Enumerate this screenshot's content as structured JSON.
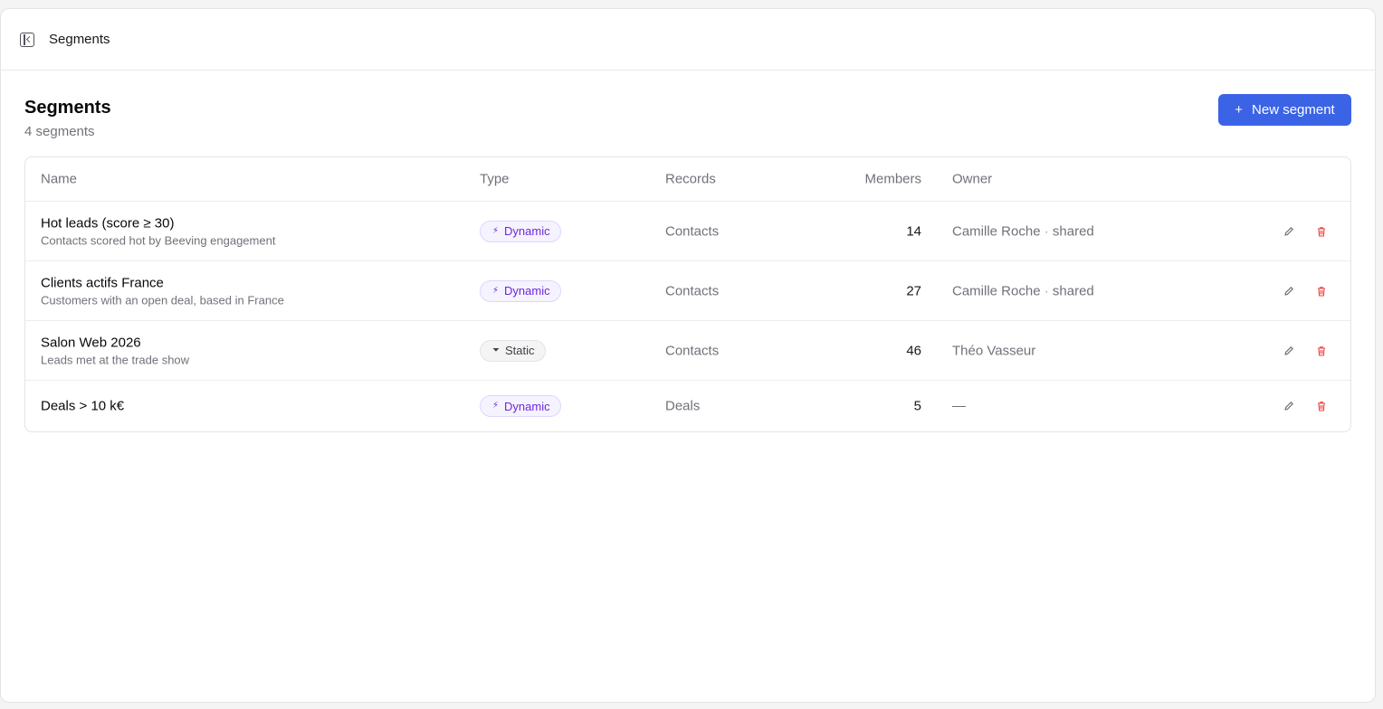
{
  "topbar": {
    "title": "Segments",
    "toggle_icon": "sidebar-toggle-icon"
  },
  "header": {
    "title": "Segments",
    "subtitle": "4 segments",
    "new_button_label": "New segment"
  },
  "table": {
    "columns": {
      "name": "Name",
      "type": "Type",
      "records": "Records",
      "members": "Members",
      "owner": "Owner"
    },
    "rows": [
      {
        "name": "Hot leads (score ≥ 30)",
        "description": "Contacts scored hot by Beeving engagement",
        "type": "Dynamic",
        "records": "Contacts",
        "members": "14",
        "owner": "Camille Roche",
        "owner_suffix": "shared"
      },
      {
        "name": "Clients actifs France",
        "description": "Customers with an open deal, based in France",
        "type": "Dynamic",
        "records": "Contacts",
        "members": "27",
        "owner": "Camille Roche",
        "owner_suffix": "shared"
      },
      {
        "name": "Salon Web 2026",
        "description": "Leads met at the trade show",
        "type": "Static",
        "records": "Contacts",
        "members": "46",
        "owner": "Théo Vasseur",
        "owner_suffix": ""
      },
      {
        "name": "Deals > 10 k€",
        "description": "",
        "type": "Dynamic",
        "records": "Deals",
        "members": "5",
        "owner": "—",
        "owner_suffix": ""
      }
    ]
  },
  "colors": {
    "accent": "#3b63e6",
    "dynamic_badge": "#6d28d9",
    "delete": "#ef4444"
  },
  "icons": {
    "dynamic": "bolt-icon",
    "static": "filter-icon",
    "edit": "pencil-icon",
    "delete": "trash-icon"
  }
}
